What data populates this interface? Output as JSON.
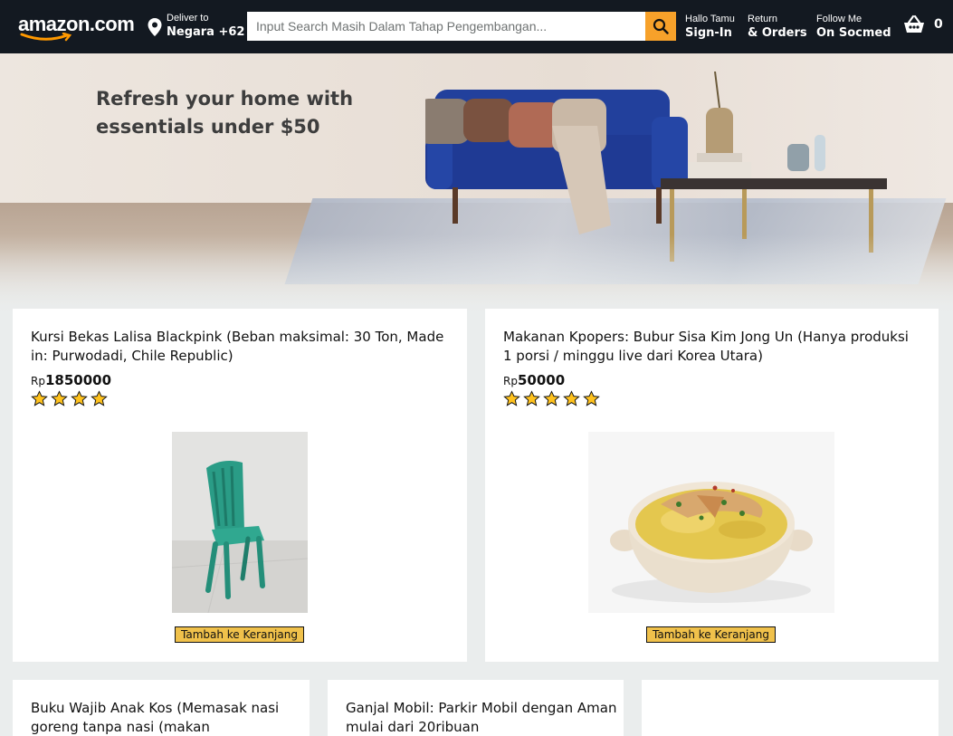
{
  "header": {
    "logo_text": "amazon.com",
    "deliver": {
      "line1": "Deliver to",
      "line2": "Negara +62"
    },
    "search": {
      "placeholder": "Input Search Masih Dalam Tahap Pengembangan..."
    },
    "account": {
      "line1": "Hallo Tamu",
      "line2": "Sign-In"
    },
    "orders": {
      "line1": "Return",
      "line2": "& Orders"
    },
    "social": {
      "line1": "Follow Me",
      "line2": "On Socmed"
    },
    "cart_count": "0",
    "colors": {
      "bar": "#131921",
      "search_button": "#f7a12a"
    }
  },
  "hero": {
    "title_line1": "Refresh your home with",
    "title_line2": "essentials under $50"
  },
  "products": [
    {
      "title": "Kursi Bekas Lalisa Blackpink (Beban maksimal: 30 Ton, Made in: Purwodadi, Chile Republic)",
      "currency": "Rp",
      "price": "1850000",
      "rating": 4,
      "image": "green-plastic-chair",
      "button": "Tambah ke Keranjang"
    },
    {
      "title": "Makanan Kpopers: Bubur Sisa Kim Jong Un (Hanya produksi 1 porsi / minggu live dari Korea Utara)",
      "currency": "Rp",
      "price": "50000",
      "rating": 5,
      "image": "rice-porridge-bowl",
      "button": "Tambah ke Keranjang"
    },
    {
      "title": "Buku Wajib Anak Kos (Memasak nasi goreng tanpa nasi (makan",
      "image": ""
    },
    {
      "title": "Ganjal Mobil: Parkir Mobil dengan Aman mulai dari 20ribuan",
      "image": ""
    },
    {
      "title": "",
      "image": ""
    }
  ],
  "colors": {
    "star": "#ffc21e",
    "add_button": "#f0c14b",
    "page_bg": "#eaeded"
  }
}
